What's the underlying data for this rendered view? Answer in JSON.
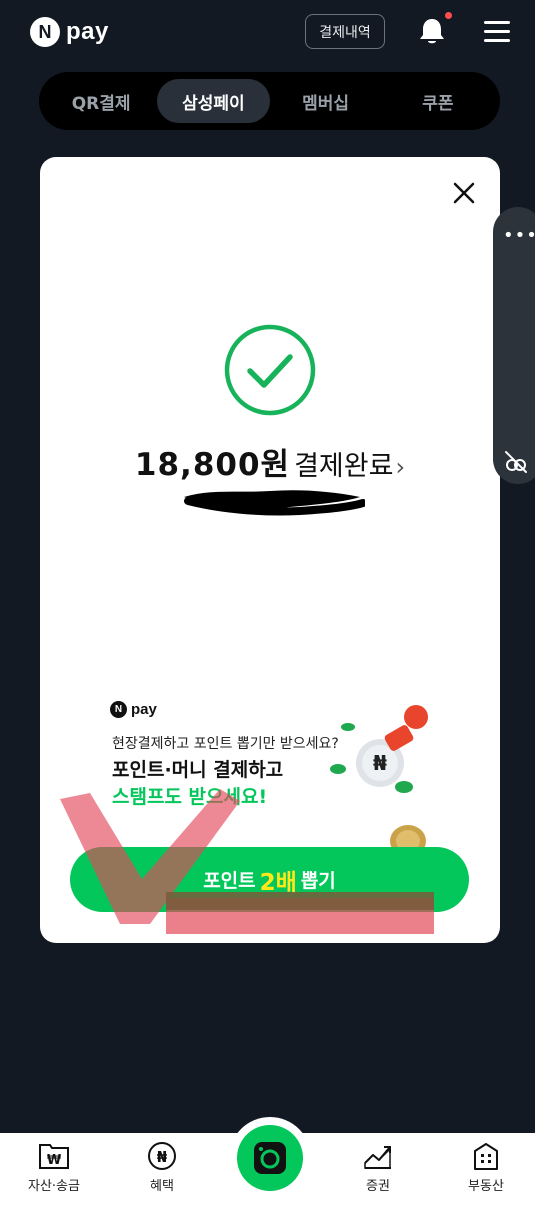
{
  "header": {
    "logo_letter": "N",
    "logo_text": "pay",
    "history_label": "결제내역",
    "bell_icon": "bell-icon",
    "menu_icon": "hamburger-menu-icon"
  },
  "tabs": [
    {
      "label": "QR결제",
      "active": false
    },
    {
      "label": "삼성페이",
      "active": true
    },
    {
      "label": "멤버십",
      "active": false
    },
    {
      "label": "쿠폰",
      "active": false
    }
  ],
  "modal": {
    "amount": "18,800원",
    "status": "결제완료",
    "chevron": "›",
    "promo": {
      "logo_letter": "N",
      "logo_text": "pay",
      "subtitle": "현장결제하고 포인트 뽑기만 받으세요?",
      "title_line1": "포인트·머니 결제하고",
      "title_line2": "스탬프도 받으세요!",
      "cta_prefix": "포인트",
      "cta_highlight": "2배",
      "cta_suffix": "뽑기"
    }
  },
  "side_widget": {
    "dots": "•••"
  },
  "bottom_nav": [
    {
      "label": "자산·송금",
      "icon": "wallet-icon"
    },
    {
      "label": "혜택",
      "icon": "benefit-coin-icon"
    },
    {
      "label": "",
      "icon": "camera-icon"
    },
    {
      "label": "증권",
      "icon": "stock-chart-icon"
    },
    {
      "label": "부동산",
      "icon": "building-icon"
    }
  ],
  "colors": {
    "background": "#121922",
    "brand_green": "#03c75a",
    "highlight_yellow": "#ffe81a",
    "notification_red": "#ff4d4f"
  }
}
